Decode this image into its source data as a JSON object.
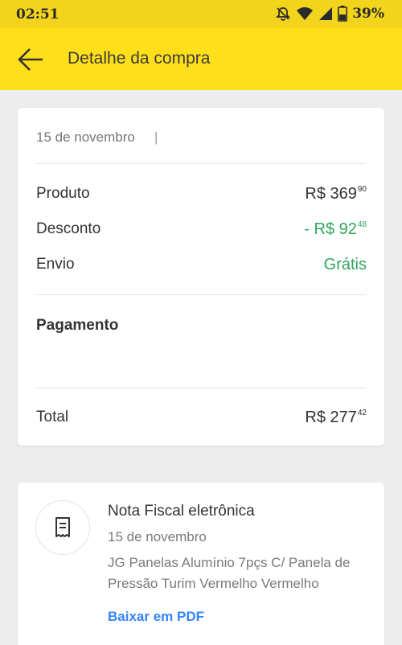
{
  "status_bar": {
    "time": "02:51",
    "battery": "39%",
    "icons": [
      "bell-muted-icon",
      "wifi-icon",
      "signal-icon",
      "battery-icon"
    ]
  },
  "app_bar": {
    "back_icon": "arrow-left-icon",
    "title": "Detalhe da compra"
  },
  "summary": {
    "date": "15 de novembro",
    "separator": "|",
    "rows": [
      {
        "label": "Produto",
        "value_main": "R$ 369",
        "value_cents": "90"
      },
      {
        "label": "Desconto",
        "value_main": "- R$ 92",
        "value_cents": "48"
      },
      {
        "label": "Envio",
        "value_main": "Grátis",
        "value_cents": ""
      }
    ],
    "payment_label": "Pagamento",
    "total_label": "Total",
    "total_main": "R$ 277",
    "total_cents": "42"
  },
  "invoice": {
    "icon": "receipt-icon",
    "title": "Nota Fiscal eletrônica",
    "date": "15 de novembro",
    "description": "JG Panelas Alumínio 7pçs C/ Panela de Pressão Turim Vermelho Vermelho",
    "link": "Baixar em PDF"
  },
  "colors": {
    "accent_yellow": "#ffdf1a",
    "green": "#2ea55d",
    "link_blue": "#3483fa"
  }
}
